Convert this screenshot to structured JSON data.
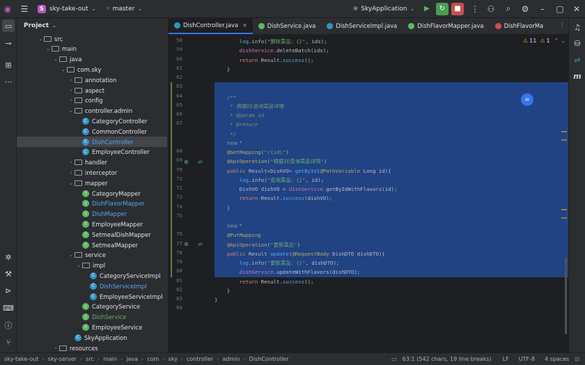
{
  "titlebar": {
    "project_badge": "S",
    "project_name": "sky-take-out",
    "branch": "master",
    "run_config": "SkyApplication"
  },
  "colors": {
    "accent": "#3574f0",
    "selection": "#214283",
    "run_green": "#499c54",
    "stop_red": "#c94f4f"
  },
  "project_panel": {
    "title": "Project",
    "tree": [
      {
        "label": "src",
        "indent": 3,
        "type": "folder",
        "open": true
      },
      {
        "label": "main",
        "indent": 4,
        "type": "folder",
        "open": true
      },
      {
        "label": "java",
        "indent": 5,
        "type": "folder",
        "open": true
      },
      {
        "label": "com.sky",
        "indent": 6,
        "type": "folder",
        "open": true
      },
      {
        "label": "annotation",
        "indent": 7,
        "type": "folder",
        "open": false
      },
      {
        "label": "aspect",
        "indent": 7,
        "type": "folder",
        "open": false
      },
      {
        "label": "config",
        "indent": 7,
        "type": "folder",
        "open": false
      },
      {
        "label": "controller.admin",
        "indent": 7,
        "type": "folder",
        "open": true
      },
      {
        "label": "CategoryController",
        "indent": 8,
        "type": "class"
      },
      {
        "label": "CommonController",
        "indent": 8,
        "type": "class"
      },
      {
        "label": "DishController",
        "indent": 8,
        "type": "class",
        "selected": true,
        "color": "#56a8f5"
      },
      {
        "label": "EmployeeController",
        "indent": 8,
        "type": "class"
      },
      {
        "label": "handler",
        "indent": 7,
        "type": "folder",
        "open": false
      },
      {
        "label": "interceptor",
        "indent": 7,
        "type": "folder",
        "open": false
      },
      {
        "label": "mapper",
        "indent": 7,
        "type": "folder",
        "open": true
      },
      {
        "label": "CategoryMapper",
        "indent": 8,
        "type": "iface"
      },
      {
        "label": "DishFlavorMapper",
        "indent": 8,
        "type": "iface",
        "color": "#56a8f5"
      },
      {
        "label": "DishMapper",
        "indent": 8,
        "type": "iface",
        "color": "#56a8f5"
      },
      {
        "label": "EmployeeMapper",
        "indent": 8,
        "type": "iface"
      },
      {
        "label": "SetmealDishMapper",
        "indent": 8,
        "type": "iface"
      },
      {
        "label": "SetmealMapper",
        "indent": 8,
        "type": "iface"
      },
      {
        "label": "service",
        "indent": 7,
        "type": "folder",
        "open": true
      },
      {
        "label": "impl",
        "indent": 8,
        "type": "folder",
        "open": true
      },
      {
        "label": "CategoryServiceImpl",
        "indent": 9,
        "type": "class"
      },
      {
        "label": "DishServiceImpl",
        "indent": 9,
        "type": "class",
        "color": "#56a8f5"
      },
      {
        "label": "EmployeeServiceImpl",
        "indent": 9,
        "type": "class"
      },
      {
        "label": "CategoryService",
        "indent": 8,
        "type": "iface"
      },
      {
        "label": "DishService",
        "indent": 8,
        "type": "iface",
        "color": "#6aab73"
      },
      {
        "label": "EmployeeService",
        "indent": 8,
        "type": "iface"
      },
      {
        "label": "SkyApplication",
        "indent": 7,
        "type": "class"
      },
      {
        "label": "resources",
        "indent": 5,
        "type": "folder",
        "open": false
      }
    ]
  },
  "tabs": [
    {
      "label": "DishController.java",
      "active": true,
      "icon_color": "#3592c4"
    },
    {
      "label": "DishService.java",
      "active": false,
      "icon_color": "#5fb865"
    },
    {
      "label": "DishServiceImpl.java",
      "active": false,
      "icon_color": "#3592c4"
    },
    {
      "label": "DishFlavorMapper.java",
      "active": false,
      "icon_color": "#5fb865"
    },
    {
      "label": "DishFlavorMa",
      "active": false,
      "icon_color": "#c94f4f"
    }
  ],
  "inspections": {
    "warnings": "11",
    "weak": "1"
  },
  "code_lines": [
    {
      "n": "58",
      "html": "        <span class='m'>log</span>.info(<span class='s'>\"删除菜品：{}\"</span>, ids);"
    },
    {
      "n": "59",
      "html": "        <span class='f'>dishService</span>.deleteBatch(ids);"
    },
    {
      "n": "60",
      "html": "        <span class='k'>return</span> Result.<span class='m'>success</span>();"
    },
    {
      "n": "61",
      "html": "    }"
    },
    {
      "n": "62",
      "html": ""
    },
    {
      "n": "63",
      "html": ""
    },
    {
      "n": "64",
      "html": "    <span class='cm'>/**</span>"
    },
    {
      "n": "65",
      "html": "     <span class='cm'>* 根据ID查询菜品详情</span>"
    },
    {
      "n": "66",
      "html": "     <span class='cm'>* @param id</span>"
    },
    {
      "n": "67",
      "html": "     <span class='cm'>* @return</span>"
    },
    {
      "n": "",
      "html": "     <span class='cm'>*/</span>"
    },
    {
      "n": "",
      "html": "    <span class='hint'>new *</span>"
    },
    {
      "n": "68",
      "html": "    <span class='an'>@GetMapping</span>(<span class='s'>\"/{id}\"</span>)"
    },
    {
      "n": "69",
      "html": "    <span class='an'>@ApiOperation</span>(<span class='s'>\"根据ID查询菜品详情\"</span>)"
    },
    {
      "n": "70",
      "html": "    <span class='k'>public</span> Result&lt;DishVO&gt; <span class='m'>getById</span>(<span class='an'>@PathVariable</span> Long id){"
    },
    {
      "n": "71",
      "html": "        <span class='m'>log</span>.info(<span class='s'>\"查询菜品：{}\"</span>, id);"
    },
    {
      "n": "72",
      "html": "        DishVO dishVO = <span class='f'>dishService</span>.getByIdWithFlavors(id);"
    },
    {
      "n": "73",
      "html": "        <span class='k'>return</span> Result.<span class='m'>success</span>(dishVO);"
    },
    {
      "n": "74",
      "html": "    }"
    },
    {
      "n": "75",
      "html": ""
    },
    {
      "n": "",
      "html": "    <span class='hint'>new *</span>"
    },
    {
      "n": "76",
      "html": "    <span class='an'>@PutMapping</span>"
    },
    {
      "n": "77",
      "html": "    <span class='an'>@ApiOperation</span>(<span class='s'>\"更新菜品\"</span>)"
    },
    {
      "n": "78",
      "html": "    <span class='k'>public</span> Result <span class='m'>update</span>(<span class='an'>@RequestBody</span> DishDTO dishDTO){"
    },
    {
      "n": "79",
      "html": "        <span class='m'>log</span>.info(<span class='s'>\"更新菜品：{}\"</span>, dishDTO);"
    },
    {
      "n": "80",
      "html": "        <span class='f'>dishService</span>.updateWithFlavors(dishDTO);"
    },
    {
      "n": "81",
      "html": "        <span class='k'>return</span> Result.<span class='m'>success</span>();"
    },
    {
      "n": "82",
      "html": "    }"
    },
    {
      "n": "83",
      "html": "}"
    },
    {
      "n": "84",
      "html": ""
    }
  ],
  "statusbar": {
    "breadcrumbs": [
      "sky-take-out",
      "sky-server",
      "src",
      "main",
      "java",
      "com",
      "sky",
      "controller",
      "admin",
      "DishController"
    ],
    "position": "63:1 (542 chars, 19 line breaks)",
    "line_sep": "LF",
    "encoding": "UTF-8",
    "indent": "4 spaces"
  }
}
